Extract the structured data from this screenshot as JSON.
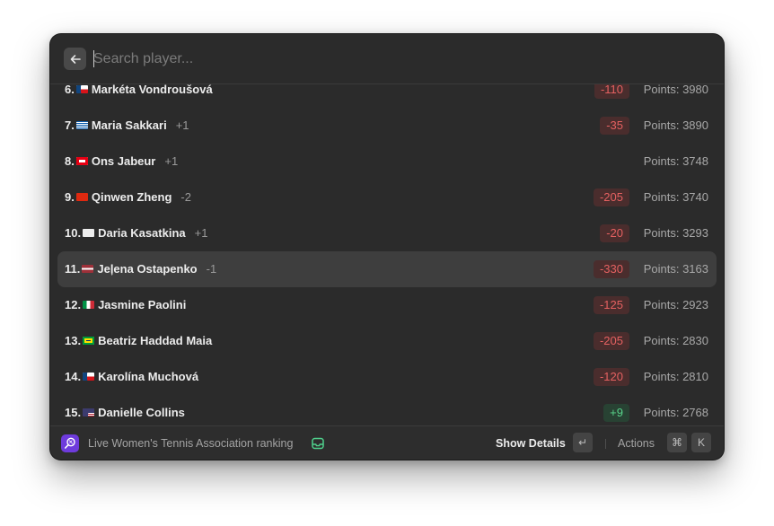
{
  "search": {
    "placeholder": "Search player..."
  },
  "rows": [
    {
      "rank": "6.",
      "name": "Markéta Vondroušová",
      "movement": "",
      "delta": "-110",
      "delta_type": "neg",
      "points": "Points: 3980",
      "flag": [
        "#ffffff",
        "#d7141a",
        "#11457e"
      ],
      "flag_kind": "cz"
    },
    {
      "rank": "7.",
      "name": "Maria Sakkari",
      "movement": "+1",
      "delta": "-35",
      "delta_type": "neg",
      "points": "Points: 3890",
      "flag": [
        "#0d5eaf",
        "#ffffff"
      ],
      "flag_kind": "gr"
    },
    {
      "rank": "8.",
      "name": "Ons Jabeur",
      "movement": "+1",
      "delta": "",
      "delta_type": "",
      "points": "Points: 3748",
      "flag": [
        "#e70013",
        "#ffffff"
      ],
      "flag_kind": "tn"
    },
    {
      "rank": "9.",
      "name": "Qinwen Zheng",
      "movement": "-2",
      "delta": "-205",
      "delta_type": "neg",
      "points": "Points: 3740",
      "flag": [
        "#de2910",
        "#ffde00"
      ],
      "flag_kind": "cn"
    },
    {
      "rank": "10.",
      "name": "Daria Kasatkina",
      "movement": "+1",
      "delta": "-20",
      "delta_type": "neg",
      "points": "Points: 3293",
      "flag": [
        "#eeeeee",
        "#dddddd"
      ],
      "flag_kind": "white"
    },
    {
      "rank": "11.",
      "name": "Jeļena Ostapenko",
      "movement": "-1",
      "delta": "-330",
      "delta_type": "neg",
      "points": "Points: 3163",
      "flag": [
        "#9e3039",
        "#ffffff"
      ],
      "flag_kind": "lv",
      "selected": true
    },
    {
      "rank": "12.",
      "name": "Jasmine Paolini",
      "movement": "",
      "delta": "-125",
      "delta_type": "neg",
      "points": "Points: 2923",
      "flag": [
        "#009246",
        "#ffffff",
        "#ce2b37"
      ],
      "flag_kind": "it"
    },
    {
      "rank": "13.",
      "name": "Beatriz Haddad Maia",
      "movement": "",
      "delta": "-205",
      "delta_type": "neg",
      "points": "Points: 2830",
      "flag": [
        "#009c3b",
        "#ffdf00",
        "#002776"
      ],
      "flag_kind": "br"
    },
    {
      "rank": "14.",
      "name": "Karolína Muchová",
      "movement": "",
      "delta": "-120",
      "delta_type": "neg",
      "points": "Points: 2810",
      "flag": [
        "#ffffff",
        "#d7141a",
        "#11457e"
      ],
      "flag_kind": "cz"
    },
    {
      "rank": "15.",
      "name": "Danielle Collins",
      "movement": "",
      "delta": "+9",
      "delta_type": "pos",
      "points": "Points: 2768",
      "flag": [
        "#b22234",
        "#ffffff",
        "#3c3b6e"
      ],
      "flag_kind": "us"
    }
  ],
  "footer": {
    "title": "Live Women's Tennis Association ranking",
    "primary_action": "Show Details",
    "enter_key": "↵",
    "actions_label": "Actions",
    "cmd_key": "⌘",
    "k_key": "K"
  },
  "colors": {
    "accent": "#6e3bdc",
    "negative": "#e56161",
    "positive": "#58d38a"
  },
  "icons": {
    "back": "arrow-left-icon",
    "app": "tennis-racket-icon",
    "badge": "inbox-icon"
  }
}
